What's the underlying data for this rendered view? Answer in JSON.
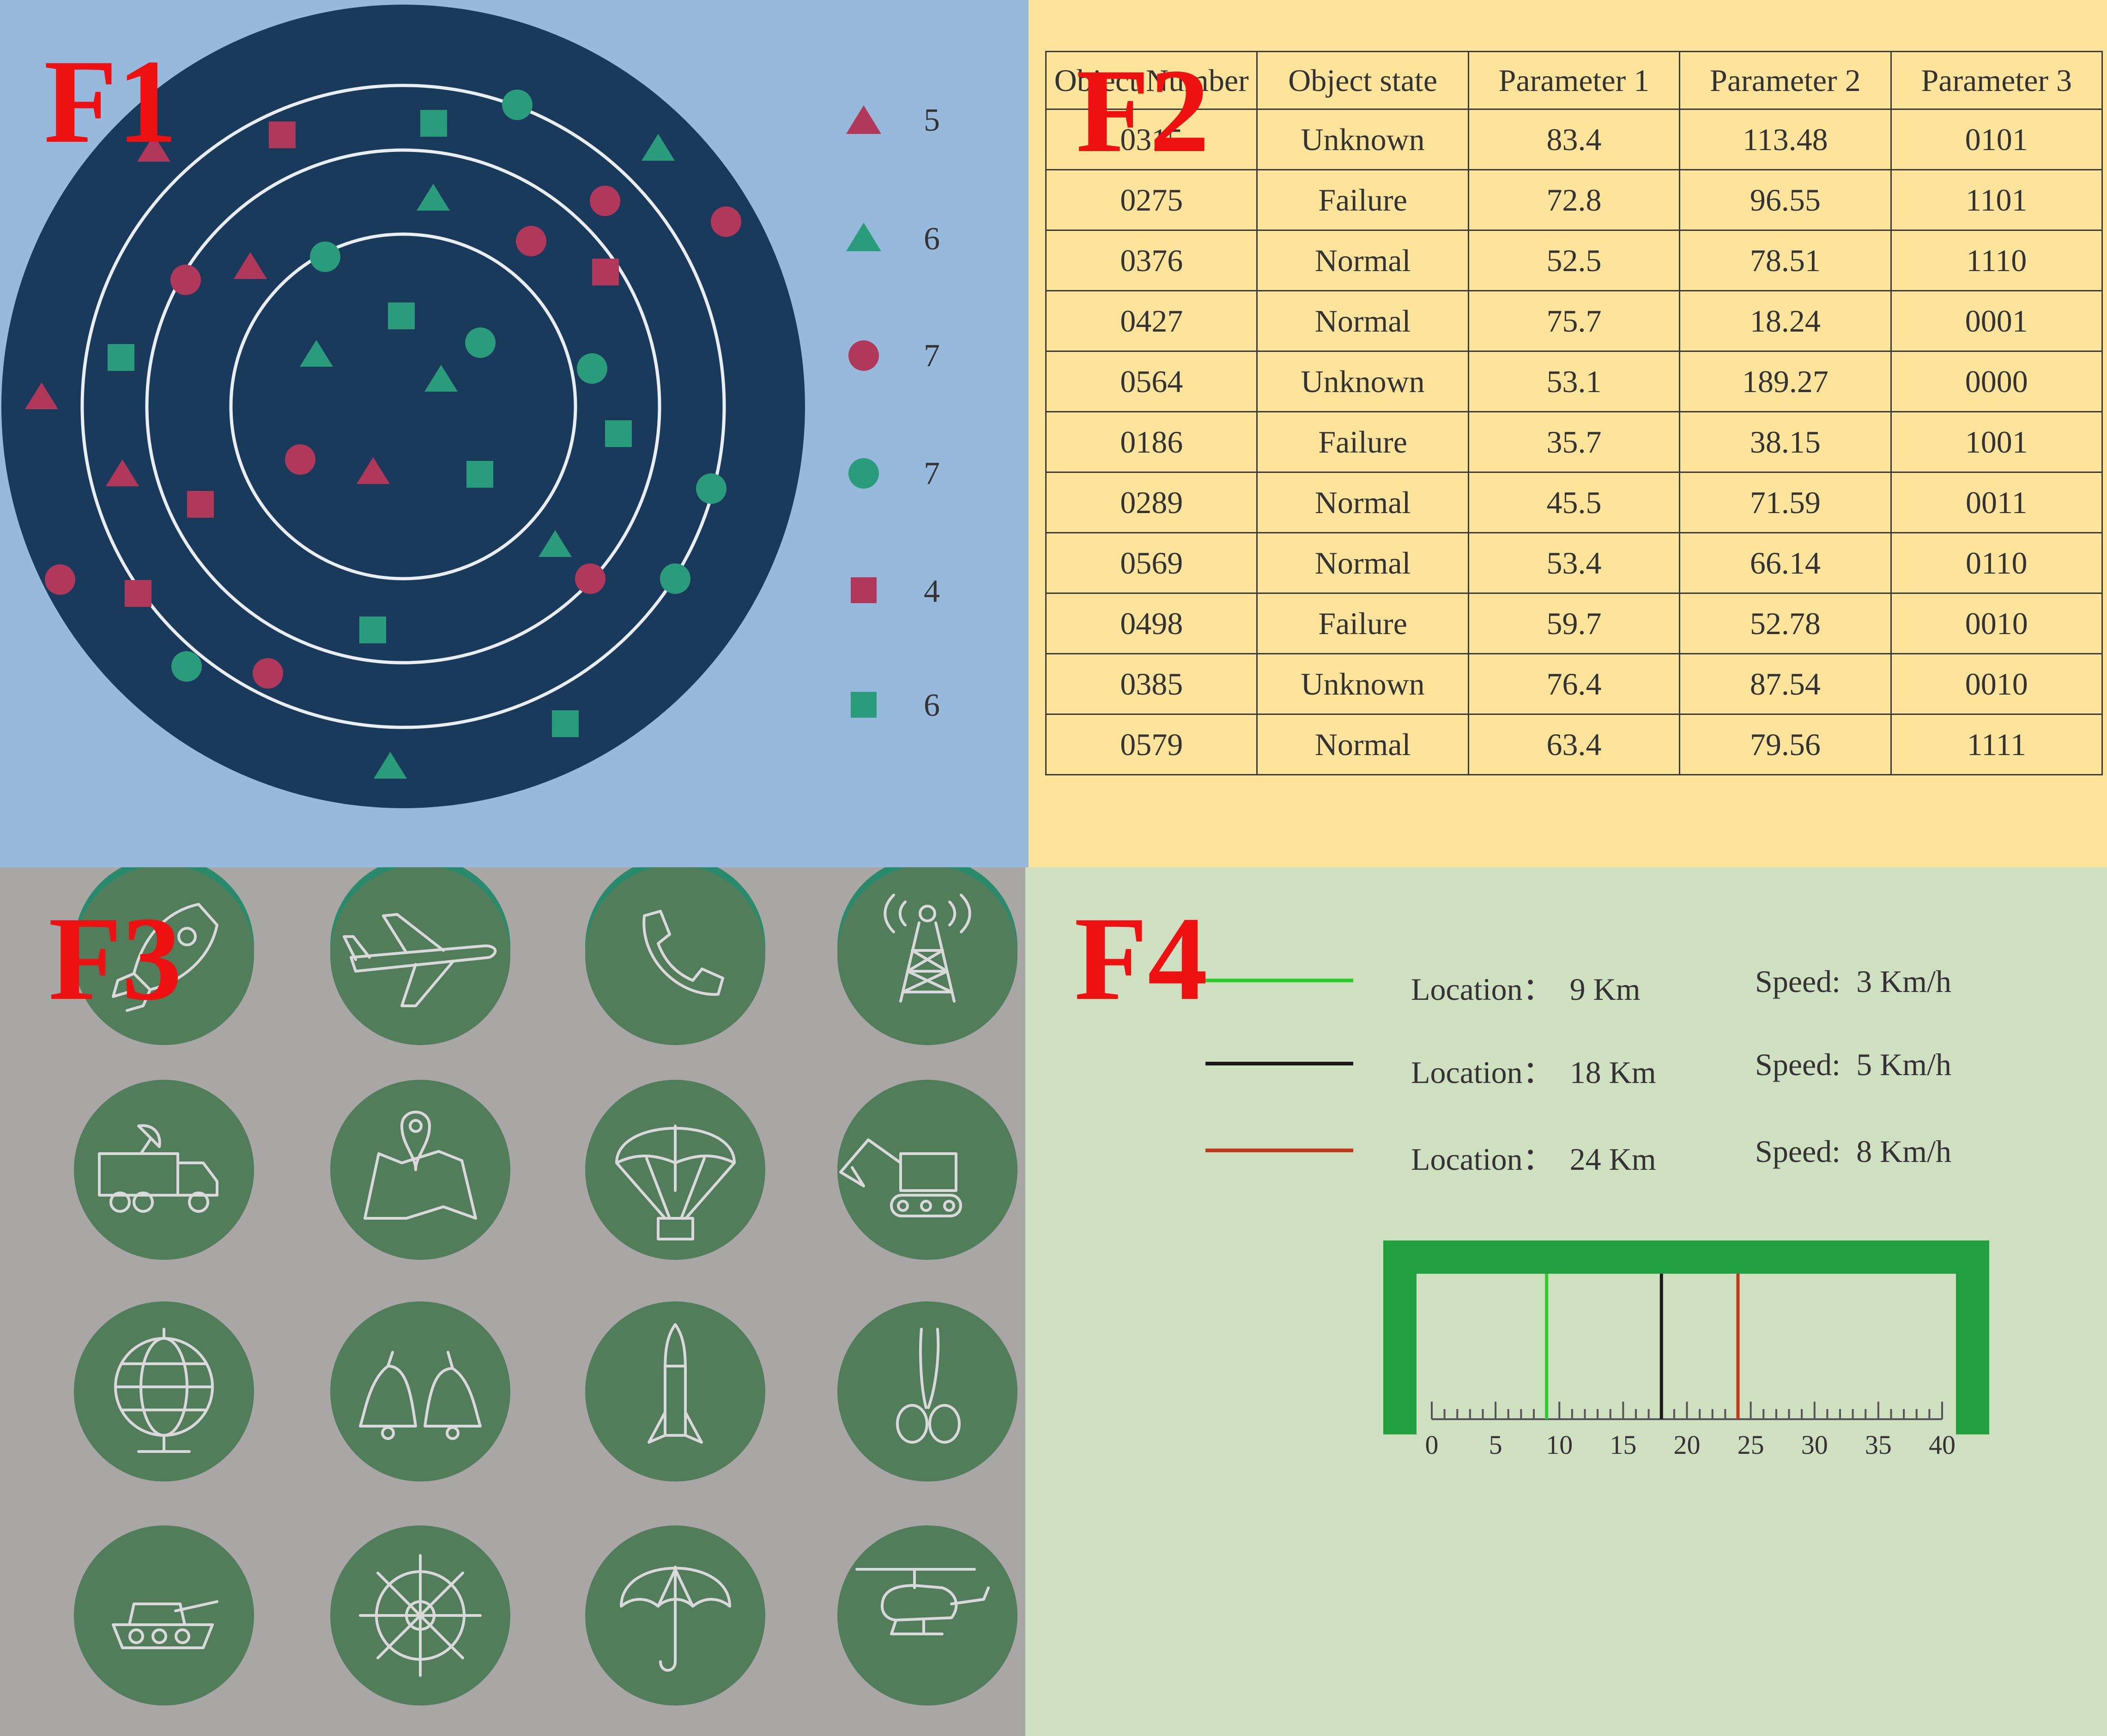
{
  "panels": {
    "f1": {
      "label": "F1",
      "legend": [
        {
          "shape": "triangle",
          "color": "#b0385a",
          "count": "5"
        },
        {
          "shape": "triangle",
          "color": "#2a9c7c",
          "count": "6"
        },
        {
          "shape": "circle",
          "color": "#b0385a",
          "count": "7"
        },
        {
          "shape": "circle",
          "color": "#2a9c7c",
          "count": "7"
        },
        {
          "shape": "square",
          "color": "#b0385a",
          "count": "4"
        },
        {
          "shape": "square",
          "color": "#2a9c7c",
          "count": "6"
        }
      ]
    },
    "f2": {
      "label": "F2",
      "columns": [
        "Object Number",
        "Object state",
        "Parameter 1",
        "Parameter 2",
        "Parameter 3"
      ],
      "rows": [
        [
          "0315",
          "Unknown",
          "83.4",
          "113.48",
          "0101"
        ],
        [
          "0275",
          "Failure",
          "72.8",
          "96.55",
          "1101"
        ],
        [
          "0376",
          "Normal",
          "52.5",
          "78.51",
          "1110"
        ],
        [
          "0427",
          "Normal",
          "75.7",
          "18.24",
          "0001"
        ],
        [
          "0564",
          "Unknown",
          "53.1",
          "189.27",
          "0000"
        ],
        [
          "0186",
          "Failure",
          "35.7",
          "38.15",
          "1001"
        ],
        [
          "0289",
          "Normal",
          "45.5",
          "71.59",
          "0011"
        ],
        [
          "0569",
          "Normal",
          "53.4",
          "66.14",
          "0110"
        ],
        [
          "0498",
          "Failure",
          "59.7",
          "52.78",
          "0010"
        ],
        [
          "0385",
          "Unknown",
          "76.4",
          "87.54",
          "0010"
        ],
        [
          "0579",
          "Normal",
          "63.4",
          "79.56",
          "1111"
        ]
      ]
    },
    "f3": {
      "label": "F3",
      "icons": [
        "rocket-icon",
        "airplane-icon",
        "phone-icon",
        "radio-tower-icon",
        "satellite-truck-icon",
        "map-pin-icon",
        "parachute-icon",
        "excavator-icon",
        "globe-icon",
        "bells-icon",
        "missile-icon",
        "scissors-icon",
        "tank-icon",
        "ship-wheel-icon",
        "umbrella-icon",
        "helicopter-icon"
      ]
    },
    "f4": {
      "label": "F4",
      "lines": [
        {
          "color": "#2ecc2e",
          "location": "Location：  9 Km",
          "speed": "Speed:  3 Km/h",
          "value": 9
        },
        {
          "color": "#1a1a1a",
          "location": "Location：  18 Km",
          "speed": "Speed:  5 Km/h",
          "value": 18
        },
        {
          "color": "#c0391b",
          "location": "Location：  24 Km",
          "speed": "Speed:  8 Km/h",
          "value": 24
        }
      ],
      "scale": {
        "min": 0,
        "max": 40,
        "ticks": [
          "0",
          "5",
          "10",
          "15",
          "20",
          "25",
          "30",
          "35",
          "40"
        ]
      },
      "frame_color": "#22a040"
    }
  }
}
